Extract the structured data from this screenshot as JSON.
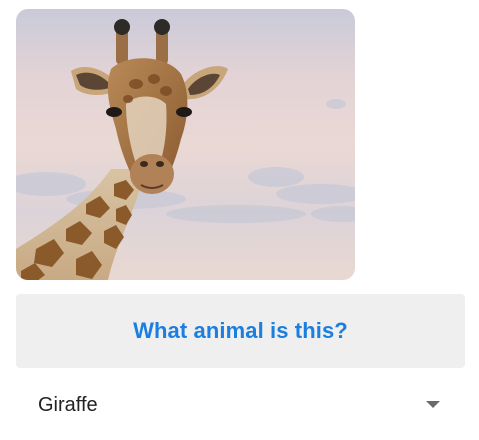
{
  "image": {
    "subject": "giraffe-photo"
  },
  "question_button": {
    "label": "What animal is this?",
    "text_color": "#1a7fe0",
    "background_color": "#efefef"
  },
  "answer_dropdown": {
    "selected_value": "Giraffe",
    "caret_icon": "caret-down-icon"
  }
}
